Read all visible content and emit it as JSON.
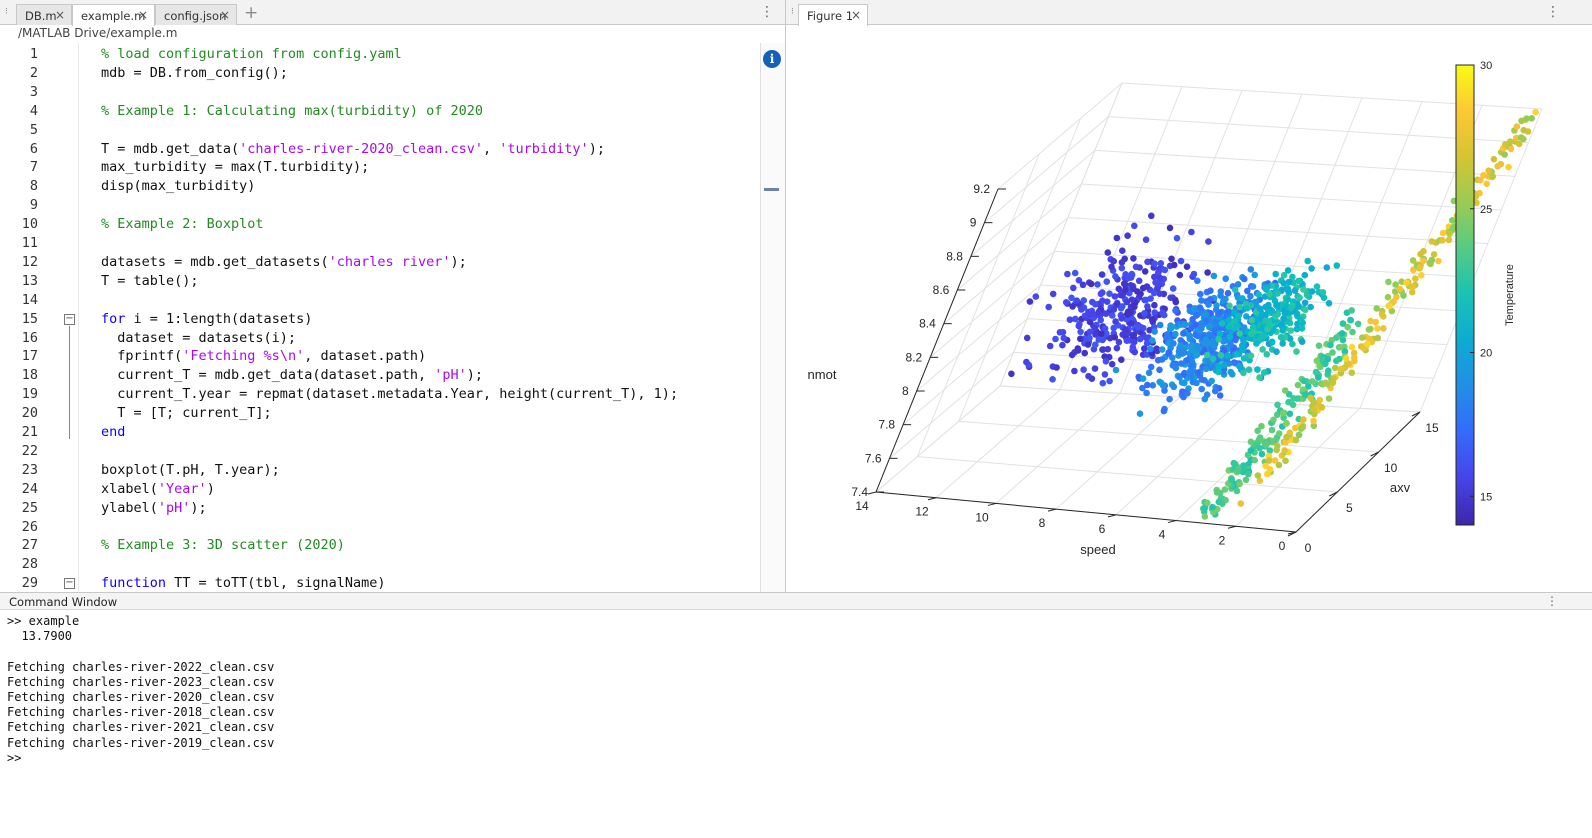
{
  "editor": {
    "tabs": [
      {
        "label": "DB.m"
      },
      {
        "label": "example.m"
      },
      {
        "label": "config.json"
      }
    ],
    "path": "/MATLAB Drive/example.m",
    "lines": [
      {
        "n": "1",
        "t": [
          [
            "c",
            "% load configuration from config.yaml"
          ]
        ]
      },
      {
        "n": "2",
        "t": [
          [
            "p",
            "mdb = DB.from_config();"
          ]
        ]
      },
      {
        "n": "3",
        "t": []
      },
      {
        "n": "4",
        "t": [
          [
            "c",
            "% Example 1: Calculating max(turbidity) of 2020"
          ]
        ]
      },
      {
        "n": "5",
        "t": []
      },
      {
        "n": "6",
        "t": [
          [
            "p",
            "T = mdb.get_data("
          ],
          [
            "s",
            "'charles-river-2020_clean.csv'"
          ],
          [
            "p",
            ", "
          ],
          [
            "s",
            "'turbidity'"
          ],
          [
            "p",
            ");"
          ]
        ]
      },
      {
        "n": "7",
        "t": [
          [
            "p",
            "max_turbidity = max(T.turbidity);"
          ]
        ]
      },
      {
        "n": "8",
        "t": [
          [
            "p",
            "disp(max_turbidity)"
          ]
        ]
      },
      {
        "n": "9",
        "t": []
      },
      {
        "n": "10",
        "t": [
          [
            "c",
            "% Example 2: Boxplot"
          ]
        ]
      },
      {
        "n": "11",
        "t": []
      },
      {
        "n": "12",
        "t": [
          [
            "p",
            "datasets = mdb.get_datasets("
          ],
          [
            "s",
            "'charles river'"
          ],
          [
            "p",
            ");"
          ]
        ]
      },
      {
        "n": "13",
        "t": [
          [
            "p",
            "T = table();"
          ]
        ]
      },
      {
        "n": "14",
        "t": []
      },
      {
        "n": "15",
        "t": [
          [
            "k",
            "for"
          ],
          [
            "p",
            " i = 1:length(datasets)"
          ]
        ]
      },
      {
        "n": "16",
        "t": [
          [
            "p",
            "  dataset = datasets(i);"
          ]
        ]
      },
      {
        "n": "17",
        "t": [
          [
            "p",
            "  fprintf("
          ],
          [
            "s",
            "'Fetching %s\\n'"
          ],
          [
            "p",
            ", dataset.path)"
          ]
        ]
      },
      {
        "n": "18",
        "t": [
          [
            "p",
            "  current_T = mdb.get_data(dataset.path, "
          ],
          [
            "s",
            "'pH'"
          ],
          [
            "p",
            ");"
          ]
        ]
      },
      {
        "n": "19",
        "t": [
          [
            "p",
            "  current_T.year = repmat(dataset.metadata.Year, height(current_T), 1);"
          ]
        ]
      },
      {
        "n": "20",
        "t": [
          [
            "p",
            "  T = [T; current_T];"
          ]
        ]
      },
      {
        "n": "21",
        "t": [
          [
            "k",
            "end"
          ]
        ]
      },
      {
        "n": "22",
        "t": []
      },
      {
        "n": "23",
        "t": [
          [
            "p",
            "boxplot(T.pH, T.year);"
          ]
        ]
      },
      {
        "n": "24",
        "t": [
          [
            "p",
            "xlabel("
          ],
          [
            "s",
            "'Year'"
          ],
          [
            "p",
            ")"
          ]
        ]
      },
      {
        "n": "25",
        "t": [
          [
            "p",
            "ylabel("
          ],
          [
            "s",
            "'pH'"
          ],
          [
            "p",
            ");"
          ]
        ]
      },
      {
        "n": "26",
        "t": []
      },
      {
        "n": "27",
        "t": [
          [
            "c",
            "% Example 3: 3D scatter (2020)"
          ]
        ]
      },
      {
        "n": "28",
        "t": []
      },
      {
        "n": "29",
        "t": [
          [
            "k",
            "function"
          ],
          [
            "p",
            " TT = toTT(tbl, signalName)"
          ]
        ]
      }
    ],
    "info_icon": "info-icon"
  },
  "figure": {
    "tab_label": "Figure 1"
  },
  "colors": {
    "comment": "#228b22",
    "string": "#a709f5",
    "keyword": "#0e00ff"
  },
  "chart_data": {
    "type": "scatter",
    "dimensions": "3d",
    "xlabel": "speed",
    "ylabel": "axv",
    "zlabel": "nmot",
    "colorbar_label": "Temperature",
    "xlim": [
      0,
      14
    ],
    "ylim": [
      0,
      15
    ],
    "zlim": [
      7.4,
      9.2
    ],
    "xticks": [
      0,
      2,
      4,
      6,
      8,
      10,
      12,
      14
    ],
    "yticks": [
      0,
      5,
      10,
      15
    ],
    "zticks": [
      7.4,
      7.6,
      7.8,
      8,
      8.2,
      8.4,
      8.6,
      8.8,
      9,
      9.2
    ],
    "colorbar_ticks": [
      15,
      20,
      25,
      30
    ],
    "clim": [
      14,
      30
    ],
    "colormap": "parula",
    "grid": true,
    "clusters": [
      {
        "temperature_range": [
          14.5,
          16.5
        ],
        "speed_center": 9.2,
        "axv_center": 4.5,
        "nmot_center": 8.35,
        "count": 330
      },
      {
        "temperature_range": [
          17,
          20
        ],
        "speed_center": 6.0,
        "axv_center": 4.5,
        "nmot_center": 8.25,
        "count": 420
      },
      {
        "temperature_range": [
          20,
          23
        ],
        "speed_center": 4.6,
        "axv_center": 6.5,
        "nmot_center": 8.3,
        "count": 240
      },
      {
        "temperature_range": [
          22,
          24.5
        ],
        "speed_center": 2.6,
        "axv_center": 3.0,
        "nmot_center": 7.8,
        "count": 170
      },
      {
        "temperature_range": [
          24.5,
          29
        ],
        "speed_center": 1.0,
        "axv_center": 9.5,
        "nmot_center": 8.7,
        "count": 210
      }
    ]
  },
  "command_window": {
    "title": "Command Window",
    "lines": [
      ">> example",
      "  13.7900",
      "",
      "Fetching charles-river-2022_clean.csv",
      "Fetching charles-river-2023_clean.csv",
      "Fetching charles-river-2020_clean.csv",
      "Fetching charles-river-2018_clean.csv",
      "Fetching charles-river-2021_clean.csv",
      "Fetching charles-river-2019_clean.csv",
      ">>"
    ]
  }
}
